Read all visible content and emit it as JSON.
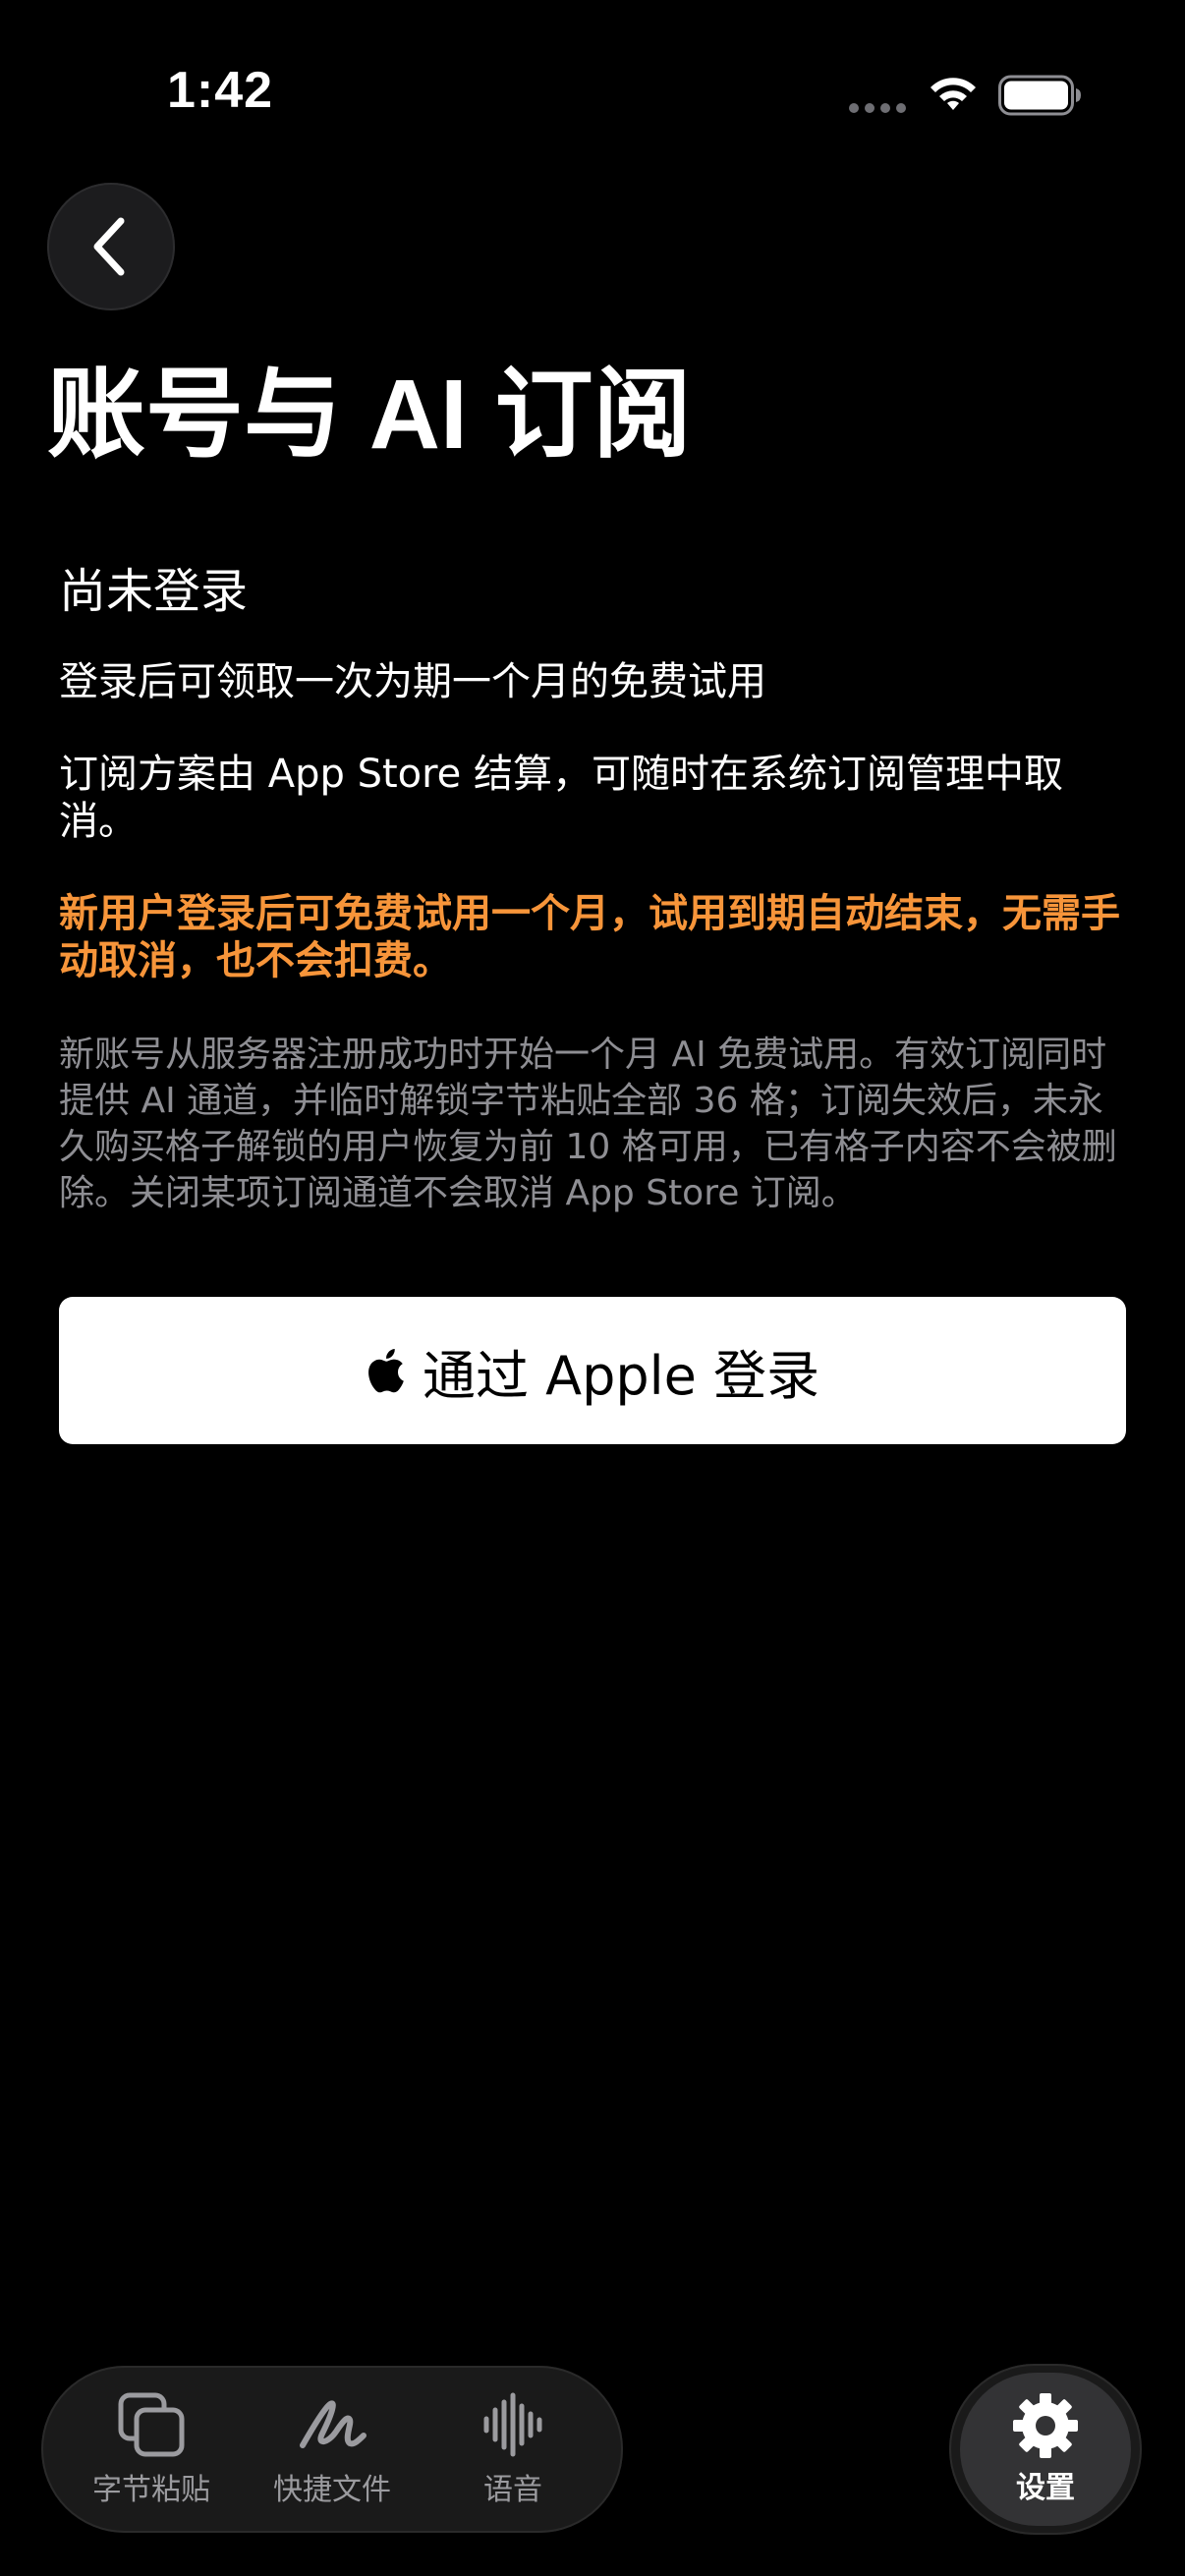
{
  "status_bar": {
    "time": "1:42"
  },
  "header": {
    "back_icon": "chevron-left-icon",
    "title": "账号与 AI 订阅"
  },
  "account": {
    "status": "尚未登录",
    "trial_note": "登录后可领取一次为期一个月的免费试用",
    "billing_note": "订阅方案由 App Store 结算，可随时在系统订阅管理中取消。",
    "highlight_note": "新用户登录后可免费试用一个月，试用到期自动结束，无需手动取消，也不会扣费。",
    "detail_note": "新账号从服务器注册成功时开始一个月 AI 免费试用。有效订阅同时提供 AI 通道，并临时解锁字节粘贴全部 36 格；订阅失效后，未永久购买格子解锁的用户恢复为前 10 格可用，已有格子内容不会被删除。关闭某项订阅通道不会取消 App Store 订阅。"
  },
  "sign_in_button": {
    "icon": "apple-logo-icon",
    "label": "通过 Apple 登录"
  },
  "tab_bar": {
    "tabs": [
      {
        "label": "字节粘贴",
        "icon": "copy-icon"
      },
      {
        "label": "快捷文件",
        "icon": "scribble-icon"
      },
      {
        "label": "语音",
        "icon": "waveform-icon"
      }
    ],
    "settings": {
      "label": "设置",
      "icon": "gear-icon"
    }
  },
  "colors": {
    "background": "#000000",
    "highlight": "#f7953a",
    "muted_text": "#8e8e93",
    "button_bg": "#ffffff"
  }
}
